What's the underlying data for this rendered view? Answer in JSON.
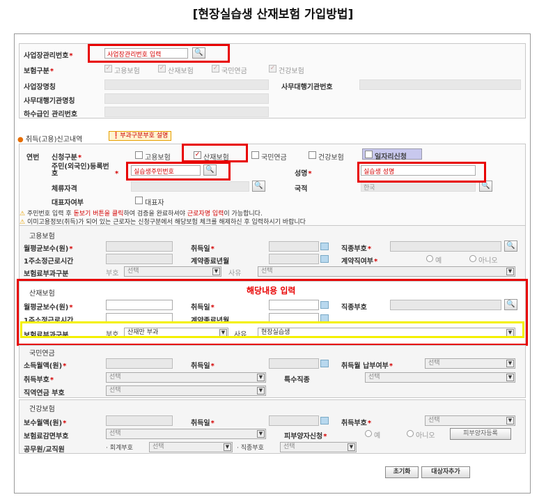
{
  "title": "[현장실습생 산재보험 가입방법]",
  "top": {
    "mgmt_label": "사업장관리번호",
    "mgmt_placeholder": "사업장관리번호 입력",
    "ins_label": "보험구분",
    "ins_opts": [
      "고용보험",
      "산재보험",
      "국민연금",
      "건강보험"
    ],
    "biz_name_label": "사업장명칭",
    "agency_no_label": "사무대행기관번호",
    "agency_name_label": "사무대행기관명칭",
    "sub_label": "하수급인 관리번호"
  },
  "report": {
    "label": "취득(고용)신고내역",
    "help_btn": "부과구분부호 설명",
    "col_no": "연번",
    "apply_label": "신청구분",
    "apply_opts": [
      "고용보험",
      "산재보험",
      "국민연금",
      "건강보험"
    ],
    "job_apply": "일자리신청",
    "rrn_label": "주민(외국인)등록번호",
    "rrn_placeholder": "실습생주민번호",
    "name_label": "성명",
    "name_placeholder": "실습생 성명",
    "stay_label": "체류자격",
    "nation_label": "국적",
    "nation_value": "한국",
    "rep_label": "대표자여부",
    "rep_opt": "대표자",
    "notice1_a": "주민번호 입력 후 ",
    "notice1_b": "돋보기 버튼을 클릭",
    "notice1_c": "하여 검증을 완료하셔야 ",
    "notice1_d": "근로자명 입력",
    "notice1_e": "이 가능합니다.",
    "notice2": "이미고용정보(취득)가 되어 있는 근로자는 신청구분에서 해당보험 체크를 해제하신 후 입력하시기 바랍니다"
  },
  "emp": {
    "title": "고용보험",
    "wage": "월평균보수(원)",
    "acq": "취득일",
    "job": "직종부호",
    "hours": "1주소정근로시간",
    "contract_end": "계약종료년월",
    "contract": "계약직여부",
    "yes": "예",
    "no": "아니오",
    "levy": "보험료부과구분",
    "code": "부호",
    "sel": "선택",
    "reason": "사유"
  },
  "ind": {
    "title": "산재보험",
    "annot": "해당내용 입력",
    "wage": "월평균보수(원)",
    "acq": "취득일",
    "job": "직종부호",
    "hours": "1주소정근로시간",
    "contract_end": "계약종료년월",
    "levy": "보험료부과구분",
    "code": "부호",
    "code_value": "산재만 부과",
    "reason": "사유",
    "reason_value": "현장실습생"
  },
  "pension": {
    "title": "국민연금",
    "income": "소득월액(원)",
    "acq": "취득일",
    "pay": "취득월 납부여부",
    "acq_code": "취득부호",
    "special": "특수직종",
    "occ": "직역연금 부호",
    "sel": "선택"
  },
  "health": {
    "title": "건강보험",
    "wage": "보수월액(원)",
    "acq": "취득일",
    "acq_code": "취득부호",
    "reduce": "보험료감면부호",
    "dependent": "피부양자신청",
    "yes": "예",
    "no": "아니오",
    "dep_btn": "피부양자등록",
    "civil": "공무원/교직원",
    "acct": "회계부호",
    "job": "직종부호",
    "sel": "선택"
  },
  "actions": {
    "reset": "초기화",
    "add": "대상자추가"
  },
  "colors": {
    "highlight_red": "#e80000",
    "highlight_yellow": "#f4f000",
    "required": "#d40000"
  }
}
